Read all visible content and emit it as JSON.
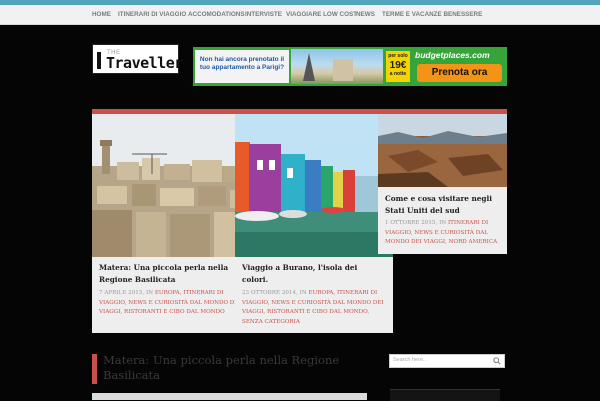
{
  "nav": {
    "items": [
      {
        "label": "HOME"
      },
      {
        "label": "ITINERARI DI VIAGGIO"
      },
      {
        "label": "ACCOMODATIONS"
      },
      {
        "label": "INTERVISTE"
      },
      {
        "label": "VIAGGIARE LOW COST"
      },
      {
        "label": "NEWS"
      },
      {
        "label": "TERME E VACANZE BENESSERE"
      }
    ]
  },
  "logo": {
    "small": "THE",
    "big": "Traveller"
  },
  "banner": {
    "question": "Non hai ancora prenotato il tuo appartamento a Parigi?",
    "badge_prefix": "per solo",
    "badge_price": "19€",
    "badge_suffix": "a notte",
    "brand": "budgetplaces.com",
    "cta": "Prenota ora"
  },
  "cards": [
    {
      "title": "Matera: Una piccola perla nella Regione Basilicata",
      "date": "7 APRILE 2015,",
      "in": "IN",
      "categories": "EUROPA, ITINERARI DI VIAGGIO, NEWS E CURIOSITÀ DAL MONDO DEI VIAGGI, RISTORANTI E CIBO DAL MONDO"
    },
    {
      "title": "Viaggio a Burano, l'isola dei colori.",
      "date": "23 OTTOBRE 2014,",
      "in": "IN",
      "categories": "EUROPA, ITINERARI DI VIAGGIO, NEWS E CURIOSITÀ DAL MONDO DEI VIAGGI, RISTORANTI E CIBO DAL MONDO, SENZA CATEGORIA"
    },
    {
      "title": "Come e cosa visitare negli Stati Uniti del sud",
      "date": "1 OTTOBRE 2015,",
      "in": "IN",
      "categories": "ITINERARI DI VIAGGIO, NEWS E CURIOSITÀ DAL MONDO DEI VIAGGI, NORD AMERICA"
    }
  ],
  "post": {
    "title": "Matera: Una piccola perla nella Regione Basilicata"
  },
  "search": {
    "placeholder": "Search here..",
    "icon": "search-icon"
  },
  "colors": {
    "accent": "#c9514a",
    "topline": "#54a4b8",
    "banner_green": "#35a53a",
    "cta_orange": "#f39416"
  }
}
